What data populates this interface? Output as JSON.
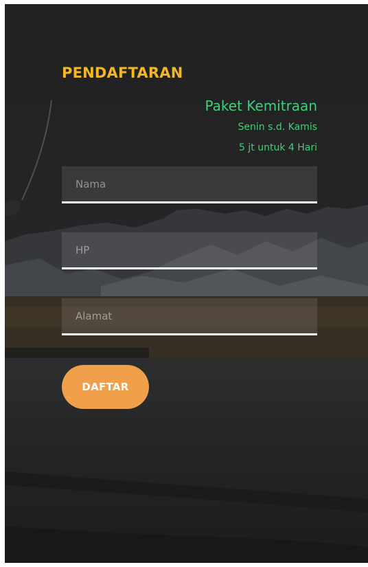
{
  "form": {
    "title": "PENDAFTARAN",
    "package_name": "Paket Kemitraan",
    "package_days": "Senin s.d. Kamis",
    "package_price": "5 jt untuk 4 Hari",
    "fields": [
      {
        "placeholder": "Nama",
        "value": ""
      },
      {
        "placeholder": "HP",
        "value": ""
      },
      {
        "placeholder": "Alamat",
        "value": ""
      }
    ],
    "submit_label": "DAFTAR"
  },
  "colors": {
    "title": "#f2b722",
    "package_text": "#3fd07a",
    "button": "#f0a04b",
    "field_underline": "#ffffff"
  }
}
